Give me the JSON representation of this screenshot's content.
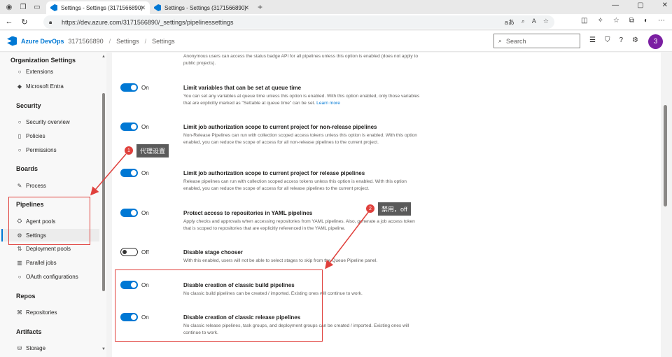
{
  "browser": {
    "tabs": [
      {
        "title": "Settings - Settings (3171566890)",
        "active": true
      },
      {
        "title": "Settings - Settings (3171566890)",
        "active": false
      }
    ],
    "url": "https://dev.azure.com/3171566890/_settings/pipelinessettings",
    "url_display": "https://dev.azure.com/3171566890/_settings/pipelinessettings"
  },
  "app": {
    "brand": "Azure DevOps",
    "org": "3171566890",
    "crumb1": "Settings",
    "crumb2": "Settings",
    "search_placeholder": "Search",
    "avatar": "3"
  },
  "sidebar": {
    "header": "Organization Settings",
    "items": [
      {
        "label": "Extensions",
        "icon": "extensions-icon"
      },
      {
        "label": "Microsoft Entra",
        "icon": "entra-icon"
      },
      {
        "section": "Security"
      },
      {
        "label": "Security overview",
        "icon": "shield-icon"
      },
      {
        "label": "Policies",
        "icon": "policy-icon"
      },
      {
        "label": "Permissions",
        "icon": "lock-icon"
      },
      {
        "section": "Boards"
      },
      {
        "label": "Process",
        "icon": "process-icon"
      },
      {
        "section": "Pipelines"
      },
      {
        "label": "Agent pools",
        "icon": "agent-icon"
      },
      {
        "label": "Settings",
        "icon": "gear-icon",
        "selected": true
      },
      {
        "label": "Deployment pools",
        "icon": "deploy-icon"
      },
      {
        "label": "Parallel jobs",
        "icon": "parallel-icon"
      },
      {
        "label": "OAuth configurations",
        "icon": "oauth-icon"
      },
      {
        "section": "Repos"
      },
      {
        "label": "Repositories",
        "icon": "repo-icon"
      },
      {
        "section": "Artifacts"
      },
      {
        "label": "Storage",
        "icon": "storage-icon"
      }
    ]
  },
  "settings": {
    "top_desc": "Anonymous users can access the status badge API for all pipelines unless this option is enabled (does not apply to public projects).",
    "options": [
      {
        "state": "On",
        "title": "Limit variables that can be set at queue time",
        "desc": "You can set any variables at queue time unless this option is enabled. With this option enabled, only those variables that are explicitly marked as \"Settable at queue time\" can be set.",
        "link": "Learn more"
      },
      {
        "state": "On",
        "title": "Limit job authorization scope to current project for non-release pipelines",
        "desc": "Non-Release Pipelines can run with collection scoped access tokens unless this option is enabled. With this option enabled, you can reduce the scope of access for all non-release pipelines to the current project."
      },
      {
        "state": "On",
        "title": "Limit job authorization scope to current project for release pipelines",
        "desc": "Release pipelines can run with collection scoped access tokens unless this option is enabled. With this option enabled, you can reduce the scope of access for all release pipelines to the current project."
      },
      {
        "state": "On",
        "title": "Protect access to repositories in YAML pipelines",
        "desc": "Apply checks and approvals when accessing repositories from YAML pipelines. Also, generate a job access token that is scoped to repositories that are explicitly referenced in the YAML pipeline."
      },
      {
        "state": "Off",
        "title": "Disable stage chooser",
        "desc": "With this enabled, users will not be able to select stages to skip from the Queue Pipeline panel."
      },
      {
        "state": "On",
        "title": "Disable creation of classic build pipelines",
        "desc": "No classic build pipelines can be created / imported. Existing ones will continue to work."
      },
      {
        "state": "On",
        "title": "Disable creation of classic release pipelines",
        "desc": "No classic release pipelines, task groups, and deployment groups can be created / imported. Existing ones will continue to work."
      }
    ]
  },
  "annotations": {
    "badge1": "1",
    "callout1": "代理设置",
    "badge2": "2",
    "callout2": "禁用，off"
  },
  "colors": {
    "accent": "#0078d4",
    "annotation_red": "#e0403c",
    "avatar": "#7b1fa2"
  }
}
